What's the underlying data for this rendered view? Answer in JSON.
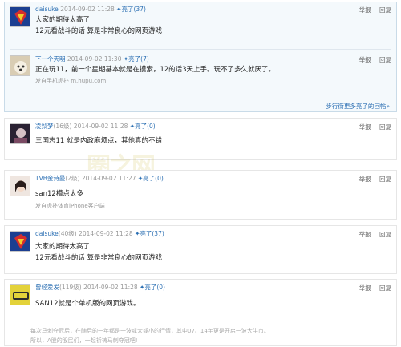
{
  "actions": {
    "report": "举报",
    "reply": "回复",
    "like_label": "亮了"
  },
  "quote": {
    "user1": {
      "name": "daisuke",
      "time": "2014-09-02 11:28",
      "lights": "(37)",
      "lines": [
        "大家的期待太高了",
        "12元看战斗的话 算是非常良心的网页游戏"
      ]
    },
    "user2": {
      "name": "下一个天明",
      "time": "2014-09-02 11:30",
      "lights": "(7)",
      "text": "正在玩11，前一个星期基本就是在摸索，12的话3天上手。玩不了多久就厌了。",
      "sub": "发自手机虎扑 m.hupu.com"
    },
    "more": "步行街更多亮了的回帖»"
  },
  "posts": [
    {
      "name": "凌梨梦",
      "level": "(16级)",
      "time": "2014-09-02 11:28",
      "lights": "(0)",
      "text": "三国志11 就是内政麻烦点，其他真的不错"
    },
    {
      "name": "TVB金诗曼",
      "level": "(2级)",
      "time": "2014-09-02 11:27",
      "lights": "(0)",
      "text": "san12槽点太多",
      "sub": "发自虎扑体育iPhone客户端"
    },
    {
      "name": "daisuke",
      "level": "(40级)",
      "time": "2014-09-02 11:28",
      "lights": "(37)",
      "lines": [
        "大家的期待太高了",
        "12元看战斗的话 算是非常良心的网页游戏"
      ]
    },
    {
      "name": "曾经爱发",
      "level": "(119级)",
      "time": "2014-09-02 11:28",
      "lights": "(0)",
      "text": "SAN12就是个单机版的网页游戏。"
    }
  ],
  "footer": [
    "每次马刺夺冠后，在随后的一年都是一波或大或小的行情，其中07、14年更是开启一波大牛市。",
    "所以，A股的股民们，一起祈祷马刺夺冠吧!"
  ],
  "watermark": "圈之网"
}
